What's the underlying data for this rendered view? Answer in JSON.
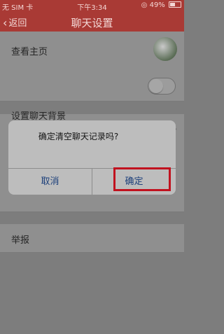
{
  "status_bar": {
    "carrier": "无 SIM 卡",
    "time": "下午3:34",
    "battery": "49%",
    "battery_level": 0.49
  },
  "navbar": {
    "back_label": "返回",
    "title": "聊天设置"
  },
  "rows": {
    "homepage": "查看主页",
    "background": "设置聊天背景",
    "report": "举报"
  },
  "dialog": {
    "message": "确定清空聊天记录吗?",
    "cancel": "取消",
    "confirm": "确定"
  },
  "colors": {
    "header": "#a93a35",
    "highlight": "#c1121f"
  }
}
